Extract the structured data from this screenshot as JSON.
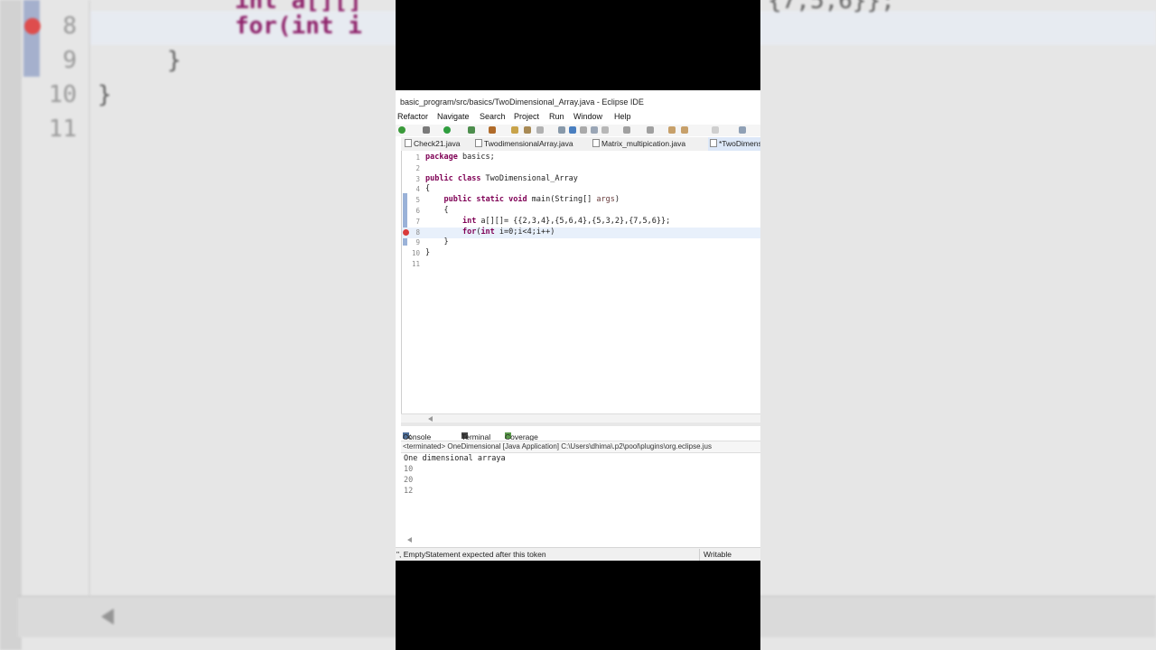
{
  "window": {
    "title": "basic_program/src/basics/TwoDimensional_Array.java - Eclipse IDE"
  },
  "menu": [
    "Refactor",
    "Navigate",
    "Search",
    "Project",
    "Run",
    "Window",
    "Help"
  ],
  "tabs": [
    {
      "label": "Check21.java",
      "active": false
    },
    {
      "label": "TwodimensionalArray.java",
      "active": false
    },
    {
      "label": "Matrix_multipication.java",
      "active": false
    },
    {
      "label": "*TwoDimens",
      "active": true
    }
  ],
  "editor": {
    "lines": [
      {
        "n": "1",
        "tokens": [
          {
            "t": "package",
            "k": "kw"
          },
          {
            "t": " basics;",
            "k": ""
          }
        ]
      },
      {
        "n": "2",
        "tokens": []
      },
      {
        "n": "3",
        "tokens": [
          {
            "t": "public",
            "k": "kw"
          },
          {
            "t": " ",
            "k": ""
          },
          {
            "t": "class",
            "k": "kw"
          },
          {
            "t": " TwoDimensional_Array",
            "k": ""
          }
        ]
      },
      {
        "n": "4",
        "tokens": [
          {
            "t": "{",
            "k": ""
          }
        ]
      },
      {
        "n": "5",
        "tokens": [
          {
            "t": "    ",
            "k": ""
          },
          {
            "t": "public",
            "k": "kw"
          },
          {
            "t": " ",
            "k": ""
          },
          {
            "t": "static",
            "k": "kw"
          },
          {
            "t": " ",
            "k": ""
          },
          {
            "t": "void",
            "k": "kw"
          },
          {
            "t": " main(String[] ",
            "k": ""
          },
          {
            "t": "args",
            "k": "arg"
          },
          {
            "t": ")",
            "k": ""
          }
        ]
      },
      {
        "n": "6",
        "tokens": [
          {
            "t": "    {",
            "k": ""
          }
        ]
      },
      {
        "n": "7",
        "tokens": [
          {
            "t": "        ",
            "k": ""
          },
          {
            "t": "int",
            "k": "kw"
          },
          {
            "t": " a[][]= {{2,3,4},{5,6,4},{5,3,2},{7,5,6}};",
            "k": ""
          }
        ]
      },
      {
        "n": "8",
        "tokens": [
          {
            "t": "        ",
            "k": ""
          },
          {
            "t": "for",
            "k": "kw"
          },
          {
            "t": "(",
            "k": ""
          },
          {
            "t": "int",
            "k": "kw"
          },
          {
            "t": " i=0;i<4;i++)",
            "k": ""
          }
        ],
        "current": true,
        "error": true
      },
      {
        "n": "9",
        "tokens": [
          {
            "t": "    }",
            "k": ""
          }
        ]
      },
      {
        "n": "10",
        "tokens": [
          {
            "t": "}",
            "k": ""
          }
        ]
      },
      {
        "n": "11",
        "tokens": []
      }
    ]
  },
  "console": {
    "tabs": [
      "Console",
      "Terminal",
      "Coverage"
    ],
    "header": "<terminated> OneDimensional [Java Application] C:\\Users\\dhima\\.p2\\pool\\plugins\\org.eclipse.jus",
    "output": [
      "One dimensional arraya",
      "10",
      "20",
      "12"
    ]
  },
  "status": {
    "message": "\", EmptyStatement expected after this token",
    "mode": "Writable"
  },
  "background": {
    "lines": [
      {
        "n": "8",
        "text": "for(int i"
      },
      {
        "n": "9",
        "text": "}"
      },
      {
        "n": "10",
        "text": "}"
      },
      {
        "n": "11",
        "text": ""
      }
    ],
    "top_left": "int a[][]",
    "top_right": "{7,5,6}};"
  }
}
